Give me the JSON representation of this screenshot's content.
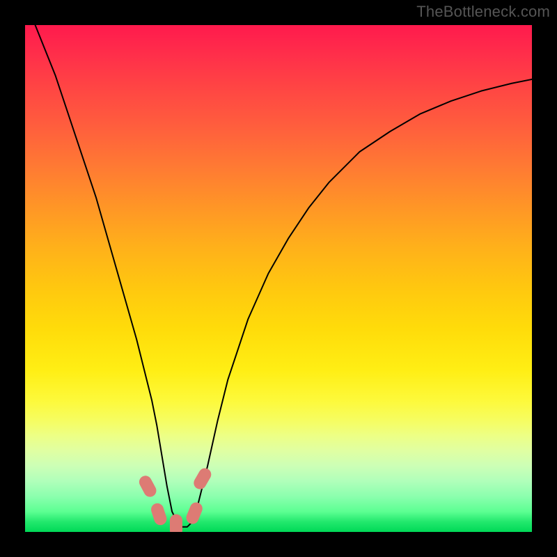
{
  "watermark": "TheBottleneck.com",
  "chart_data": {
    "type": "line",
    "title": "",
    "xlabel": "",
    "ylabel": "",
    "xlim": [
      0,
      100
    ],
    "ylim": [
      0,
      100
    ],
    "grid": false,
    "legend": false,
    "series": [
      {
        "name": "bottleneck-curve",
        "x": [
          2,
          4,
          6,
          8,
          10,
          12,
          14,
          16,
          18,
          20,
          22,
          24,
          25,
          26,
          27,
          28,
          29,
          30,
          31,
          32,
          33,
          34,
          36,
          38,
          40,
          44,
          48,
          52,
          56,
          60,
          66,
          72,
          78,
          84,
          90,
          96,
          100
        ],
        "y": [
          100,
          95,
          90,
          84,
          78,
          72,
          66,
          59,
          52,
          45,
          38,
          30,
          26,
          21,
          15,
          9,
          4,
          2,
          1,
          1,
          2,
          5,
          13,
          22,
          30,
          42,
          51,
          58,
          64,
          69,
          75,
          79,
          82.5,
          85,
          87,
          88.5,
          89.3
        ]
      }
    ],
    "markers": [
      {
        "name": "marker-1",
        "x": 24.2,
        "y": 9,
        "color": "#dd7b74"
      },
      {
        "name": "marker-2",
        "x": 26.4,
        "y": 3.5,
        "color": "#dd7b74"
      },
      {
        "name": "marker-3",
        "x": 29.8,
        "y": 1.3,
        "color": "#dd7b74"
      },
      {
        "name": "marker-4",
        "x": 33.4,
        "y": 3.7,
        "color": "#dd7b74"
      },
      {
        "name": "marker-5",
        "x": 35.0,
        "y": 10.5,
        "color": "#dd7b74"
      }
    ],
    "gradient_stops": [
      {
        "pos": 0,
        "color": "#ff1a4d"
      },
      {
        "pos": 50,
        "color": "#ffd000"
      },
      {
        "pos": 80,
        "color": "#f2ff6a"
      },
      {
        "pos": 100,
        "color": "#00d957"
      }
    ]
  }
}
